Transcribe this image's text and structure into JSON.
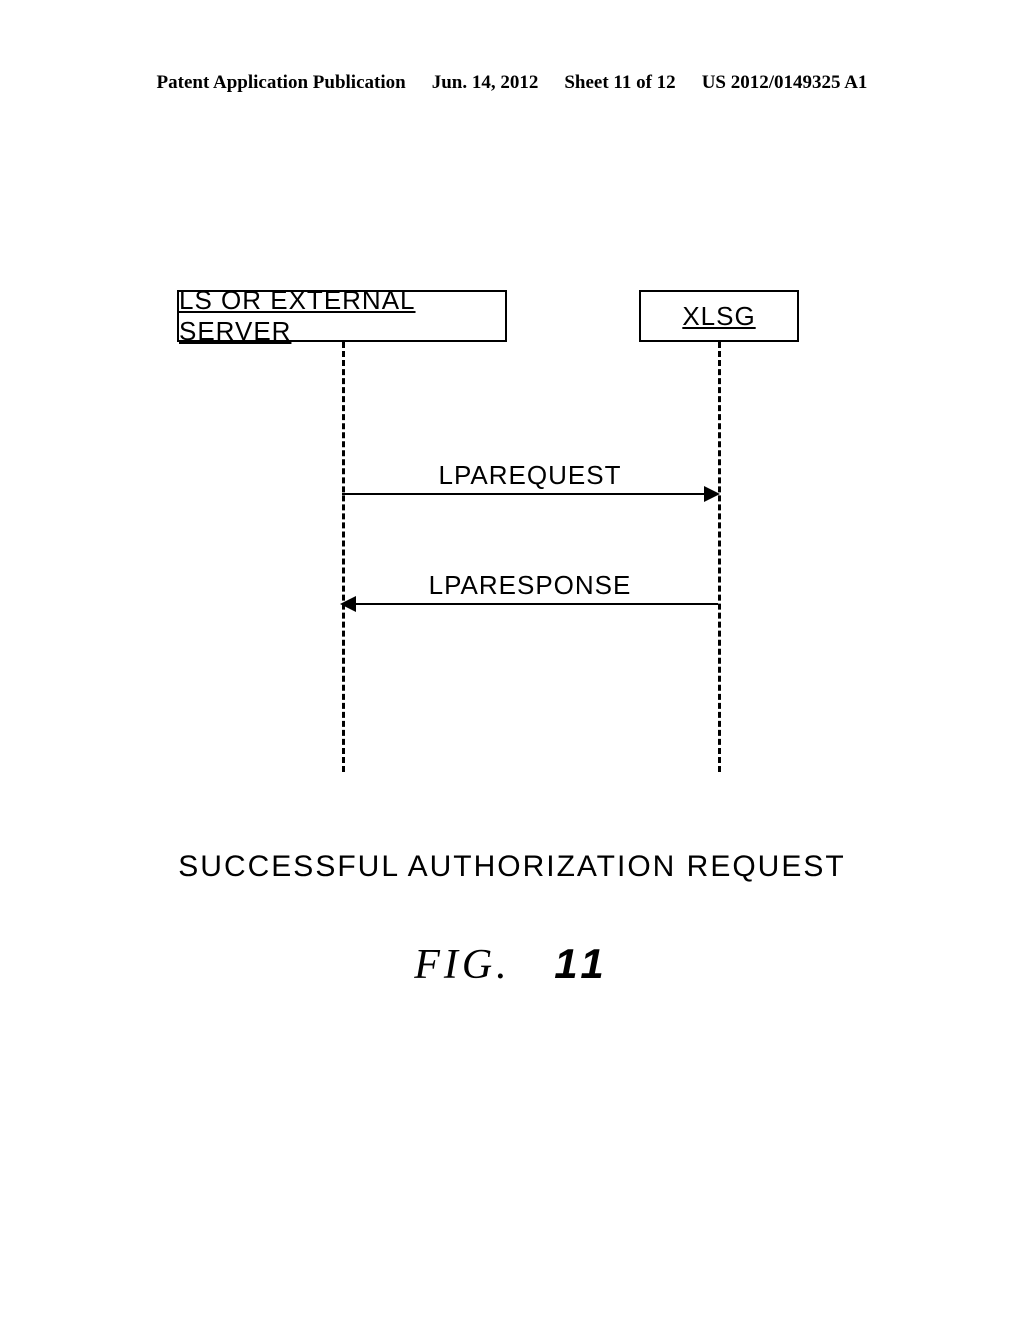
{
  "header": {
    "publication": "Patent Application Publication",
    "date": "Jun. 14, 2012",
    "sheet": "Sheet 11 of 12",
    "docnum": "US 2012/0149325 A1"
  },
  "diagram": {
    "left_box": "LS OR EXTERNAL SERVER",
    "right_box": "XLSG",
    "messages": [
      {
        "label": "LPAREQUEST",
        "direction": "right"
      },
      {
        "label": "LPARESPONSE",
        "direction": "left"
      }
    ]
  },
  "caption": "SUCCESSFUL AUTHORIZATION REQUEST",
  "figure_label": {
    "prefix": "FIG.",
    "number": "11"
  }
}
